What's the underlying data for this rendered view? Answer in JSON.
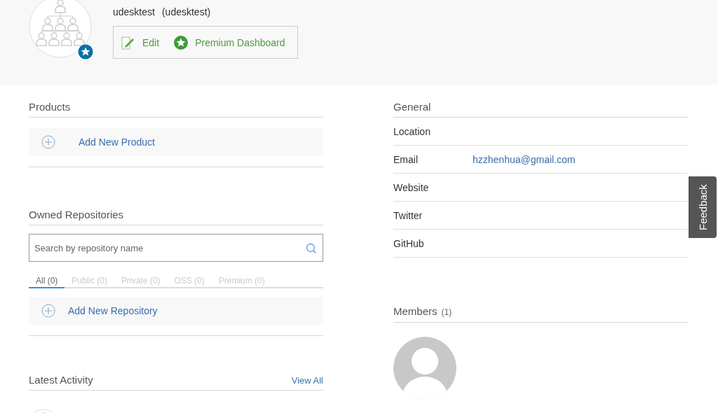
{
  "profile": {
    "name": "udesktest",
    "handle": "(udesktest)",
    "premium": true,
    "actions": [
      {
        "label": "Edit",
        "kind": "edit"
      },
      {
        "label": "Premium Dashboard",
        "kind": "premium"
      }
    ]
  },
  "products": {
    "title": "Products",
    "add_label": "Add New Product"
  },
  "repositories": {
    "title": "Owned Repositories",
    "search": {
      "placeholder": "Search by repository name"
    },
    "tabs": [
      {
        "label": "All (0)",
        "selected": true
      },
      {
        "label": "Public (0)",
        "selected": false
      },
      {
        "label": "Private (0)",
        "selected": false
      },
      {
        "label": "OSS (0)",
        "selected": false
      },
      {
        "label": "Premium (0)",
        "selected": false
      }
    ],
    "add_label": "Add New Repository"
  },
  "activity": {
    "title": "Latest Activity",
    "link": "View All"
  },
  "general": {
    "title": "General",
    "fields": [
      {
        "label": "Location"
      },
      {
        "label": "Email",
        "value": "hzzhenhua@gmail.com"
      },
      {
        "label": "Website"
      },
      {
        "label": "Twitter"
      },
      {
        "label": "GitHub"
      }
    ]
  },
  "members": {
    "title": "Members",
    "count": "(1)"
  },
  "feedback": "Feedback"
}
